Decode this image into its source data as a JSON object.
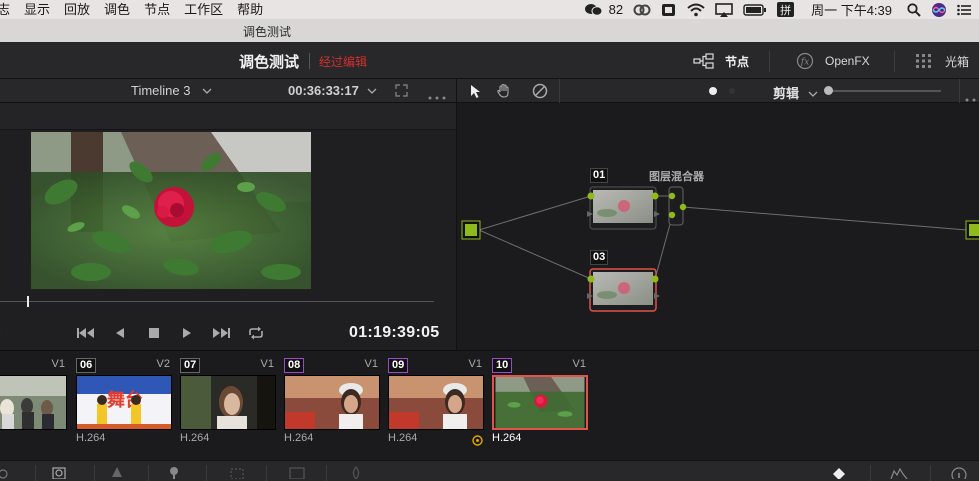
{
  "menubar": {
    "items": [
      "志",
      "显示",
      "回放",
      "调色",
      "节点",
      "工作区",
      "帮助"
    ],
    "battery": "82",
    "input_method": "拼",
    "datetime": "周一 下午4:39"
  },
  "window": {
    "title": "调色测试"
  },
  "header": {
    "project_name": "调色测试",
    "project_status": "经过编辑",
    "nodes_label": "节点",
    "openfx_label": "OpenFX",
    "lightbox_label": "光箱"
  },
  "viewer": {
    "timeline_name": "Timeline 3",
    "source_timecode": "00:36:33:17",
    "record_timecode": "01:19:39:05",
    "left_timecode_fragment": ")"
  },
  "node_editor": {
    "mode_label": "剪辑",
    "layer_mixer_label": "图层混合器",
    "nodes": [
      {
        "id": "01"
      },
      {
        "id": "03"
      }
    ]
  },
  "clips": [
    {
      "num": "",
      "track": "V1",
      "codec": "4",
      "thumb": "people"
    },
    {
      "num": "06",
      "track": "V2",
      "codec": "H.264",
      "thumb": "stage"
    },
    {
      "num": "07",
      "track": "V1",
      "codec": "H.264",
      "thumb": "girl"
    },
    {
      "num": "08",
      "track": "V1",
      "codec": "H.264",
      "thumb": "bride"
    },
    {
      "num": "09",
      "track": "V1",
      "codec": "H.264",
      "thumb": "bride"
    },
    {
      "num": "10",
      "track": "V1",
      "codec": "H.264",
      "thumb": "rose",
      "selected": true
    }
  ],
  "colors": {
    "accent_green": "#8fba1c",
    "selection_red": "#e2534a",
    "status_red": "#d0312d",
    "panel_bg": "#1b1b1d"
  }
}
